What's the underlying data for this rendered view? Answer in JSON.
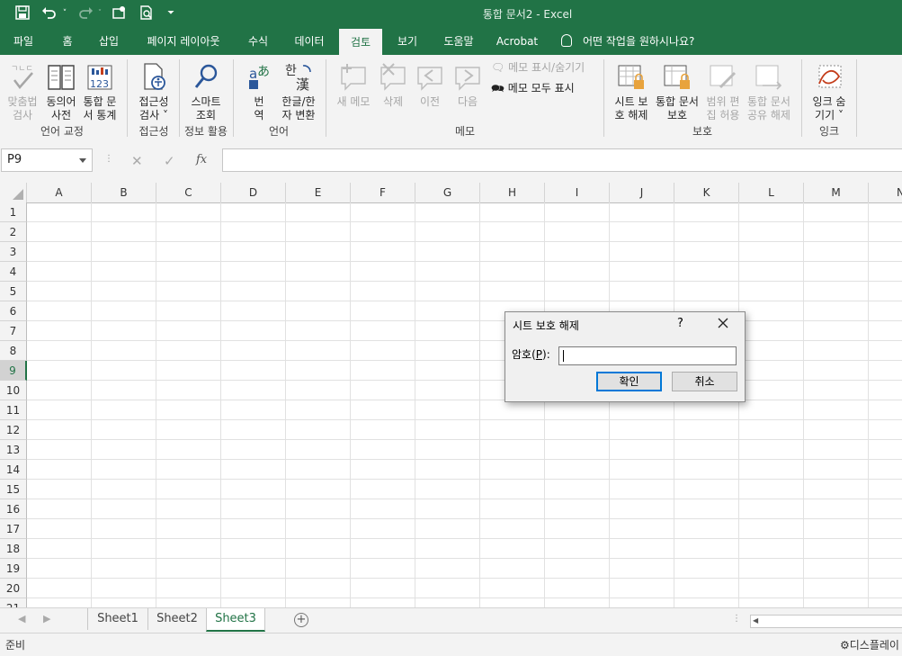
{
  "window": {
    "title": "통합 문서2  -  Excel"
  },
  "quick_access": {
    "icons": [
      "save-icon",
      "undo-icon",
      "redo-icon",
      "touch-mode-icon",
      "print-preview-icon",
      "customize-icon"
    ]
  },
  "tabs": [
    "파일",
    "홈",
    "삽입",
    "페이지 레이아웃",
    "수식",
    "데이터",
    "검토",
    "보기",
    "도움말",
    "Acrobat"
  ],
  "active_tab": "검토",
  "tell_me": "어떤 작업을 원하시나요?",
  "ribbon": {
    "proofing": {
      "spell": [
        "맞춤법",
        "검사"
      ],
      "thesaurus": [
        "동의어",
        "사전"
      ],
      "stats": [
        "통합 문",
        "서 통계"
      ],
      "label": "언어 교정"
    },
    "accessibility": {
      "check": [
        "접근성",
        "검사 ˅"
      ],
      "label": "접근성"
    },
    "insights": {
      "smart": [
        "스마트",
        "조회"
      ],
      "label": "정보 활용"
    },
    "language": {
      "translate": [
        "번",
        "역"
      ],
      "hanja": [
        "한글/한",
        "자 변환"
      ],
      "label": "언어"
    },
    "comments": {
      "new": "새 메모",
      "delete": "삭제",
      "prev": "이전",
      "next": "다음",
      "show_hide": "메모 표시/숨기기",
      "show_all": "메모 모두 표시",
      "label": "메모"
    },
    "protect": {
      "unprotect_sheet": [
        "시트 보",
        "호 해제"
      ],
      "protect_wb": [
        "통합 문서",
        "보호"
      ],
      "allow_edit": [
        "범위 편",
        "집 허용"
      ],
      "unshare": [
        "통합 문서",
        "공유 해제"
      ],
      "label": "보호"
    },
    "ink": {
      "hide": [
        "잉크 숨",
        "기기 ˅"
      ],
      "label": "잉크"
    }
  },
  "formula_bar": {
    "name_box": "P9",
    "cancel": "✕",
    "enter": "✓",
    "fx": "fx",
    "value": ""
  },
  "grid": {
    "columns": [
      "A",
      "B",
      "C",
      "D",
      "E",
      "F",
      "G",
      "H",
      "I",
      "J",
      "K",
      "L",
      "M",
      "N"
    ],
    "rows": [
      "1",
      "2",
      "3",
      "4",
      "5",
      "6",
      "7",
      "8",
      "9",
      "10",
      "11",
      "12",
      "13",
      "14",
      "15",
      "16",
      "17",
      "18",
      "19",
      "20",
      "21"
    ],
    "selected_row": "9"
  },
  "sheets": [
    "Sheet1",
    "Sheet2",
    "Sheet3"
  ],
  "active_sheet": "Sheet3",
  "status": {
    "ready": "준비",
    "display": "디스플레이"
  },
  "dialog": {
    "title": "시트 보호 해제",
    "help": "?",
    "label": "암호(P):",
    "ok": "확인",
    "cancel": "취소",
    "value": ""
  }
}
